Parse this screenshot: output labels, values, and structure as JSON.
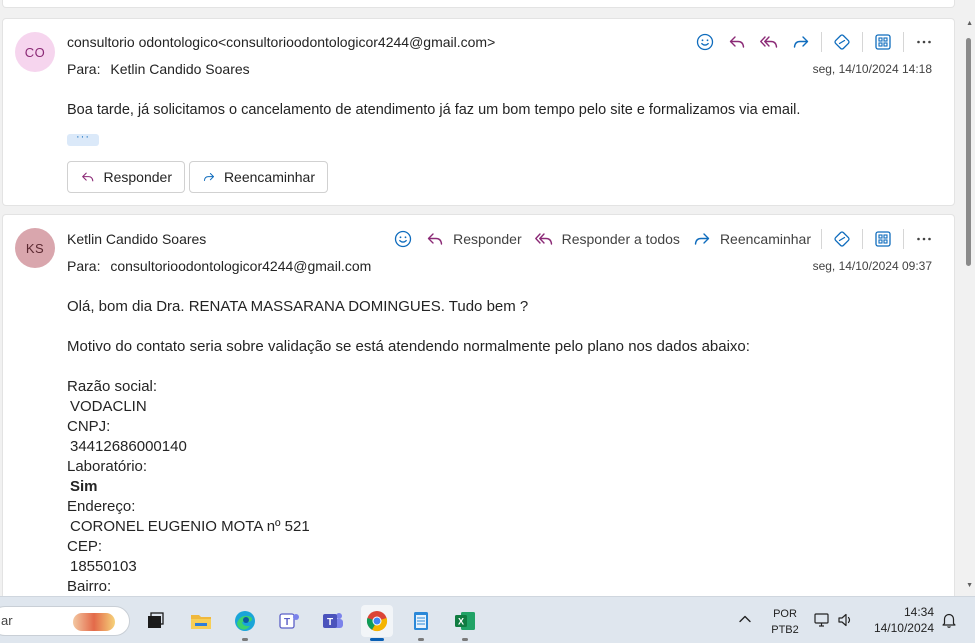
{
  "message1": {
    "avatar_initials": "CO",
    "from": "consultorio odontologico<consultorioodontologicor4244@gmail.com>",
    "to_label": "Para:",
    "to": "Ketlin Candido Soares",
    "date": "seg, 14/10/2024 14:18",
    "body": "Boa tarde, já solicitamos o cancelamento de atendimento já faz um bom tempo pelo site e formalizamos via email.",
    "more": "···",
    "reply_button": "Responder",
    "forward_button": "Reencaminhar"
  },
  "message2": {
    "avatar_initials": "KS",
    "from": "Ketlin Candido Soares",
    "to_label": "Para:",
    "to": "consultorioodontologicor4244@gmail.com",
    "date": "seg, 14/10/2024 09:37",
    "actions": {
      "reply": "Responder",
      "reply_all": "Responder a todos",
      "forward": "Reencaminhar"
    },
    "body": {
      "greeting": "Olá, bom dia Dra.  RENATA MASSARANA DOMINGUES. Tudo bem ?",
      "motivo": "Motivo do contato seria sobre validação se está atendendo normalmente pelo plano nos dados abaixo:",
      "razao_label": "Razão social:",
      "razao_value": "VODACLIN",
      "cnpj_label": "CNPJ:",
      "cnpj_value": "34412686000140",
      "lab_label": "Laboratório:",
      "lab_value": "Sim",
      "endereco_label": "Endereço:",
      "endereco_value": "CORONEL EUGENIO MOTA nº 521",
      "cep_label": "CEP:",
      "cep_value": "18550103",
      "bairro_label": "Bairro:"
    }
  },
  "taskbar": {
    "search_text": "ar",
    "language": "POR",
    "keyboard": "PTB2",
    "time": "14:34",
    "date": "14/10/2024"
  },
  "colors": {
    "accent": "#0f6cbd",
    "reply_icon": "#8b2a76",
    "avatar_co": "#f6d5ee",
    "avatar_ks": "#d9a6ad"
  }
}
